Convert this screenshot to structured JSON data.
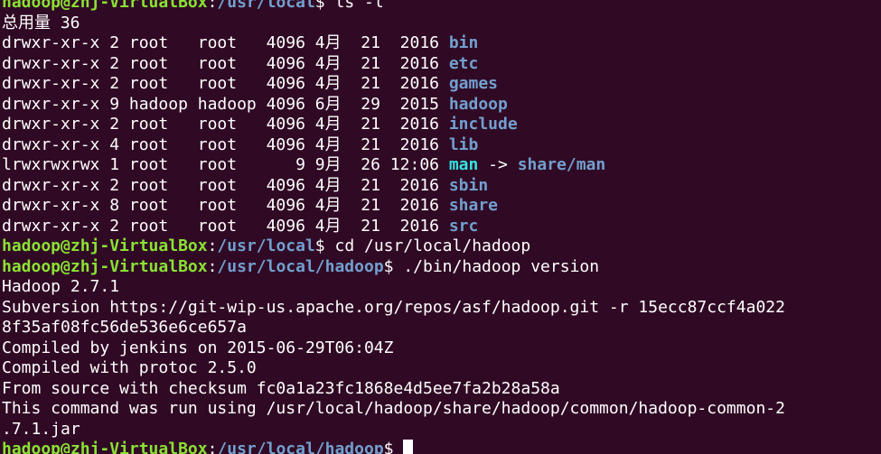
{
  "prompt": {
    "user_host": "hadoop@zhj-VirtualBox",
    "colon": ":",
    "dollar": "$"
  },
  "session": [
    {
      "type": "prompt",
      "path": "/usr/local",
      "command": " ls -l"
    },
    {
      "type": "text",
      "text": "总用量 36"
    },
    {
      "type": "ls",
      "meta": "drwxr-xr-x 2 root   root   4096 4月  21  2016 ",
      "name": "bin"
    },
    {
      "type": "ls",
      "meta": "drwxr-xr-x 2 root   root   4096 4月  21  2016 ",
      "name": "etc"
    },
    {
      "type": "ls",
      "meta": "drwxr-xr-x 2 root   root   4096 4月  21  2016 ",
      "name": "games"
    },
    {
      "type": "ls",
      "meta": "drwxr-xr-x 9 hadoop hadoop 4096 6月  29  2015 ",
      "name": "hadoop"
    },
    {
      "type": "ls",
      "meta": "drwxr-xr-x 2 root   root   4096 4月  21  2016 ",
      "name": "include"
    },
    {
      "type": "ls",
      "meta": "drwxr-xr-x 4 root   root   4096 4月  21  2016 ",
      "name": "lib"
    },
    {
      "type": "lslink",
      "meta": "lrwxrwxrwx 1 root   root      9 9月  26 12:06 ",
      "name": "man",
      "arrow": " -> ",
      "target": "share/man"
    },
    {
      "type": "ls",
      "meta": "drwxr-xr-x 2 root   root   4096 4月  21  2016 ",
      "name": "sbin"
    },
    {
      "type": "ls",
      "meta": "drwxr-xr-x 8 root   root   4096 4月  21  2016 ",
      "name": "share"
    },
    {
      "type": "ls",
      "meta": "drwxr-xr-x 2 root   root   4096 4月  21  2016 ",
      "name": "src"
    },
    {
      "type": "prompt",
      "path": "/usr/local",
      "command": " cd /usr/local/hadoop"
    },
    {
      "type": "prompt",
      "path": "/usr/local/hadoop",
      "command": " ./bin/hadoop version"
    },
    {
      "type": "text",
      "text": "Hadoop 2.7.1"
    },
    {
      "type": "text",
      "text": "Subversion https://git-wip-us.apache.org/repos/asf/hadoop.git -r 15ecc87ccf4a022"
    },
    {
      "type": "text",
      "text": "8f35af08fc56de536e6ce657a"
    },
    {
      "type": "text",
      "text": "Compiled by jenkins on 2015-06-29T06:04Z"
    },
    {
      "type": "text",
      "text": "Compiled with protoc 2.5.0"
    },
    {
      "type": "text",
      "text": "From source with checksum fc0a1a23fc1868e4d5ee7fa2b28a58a"
    },
    {
      "type": "text",
      "text": "This command was run using /usr/local/hadoop/share/hadoop/common/hadoop-common-2"
    },
    {
      "type": "text",
      "text": ".7.1.jar"
    },
    {
      "type": "prompt",
      "path": "/usr/local/hadoop",
      "command": " ",
      "cursor": true
    }
  ]
}
